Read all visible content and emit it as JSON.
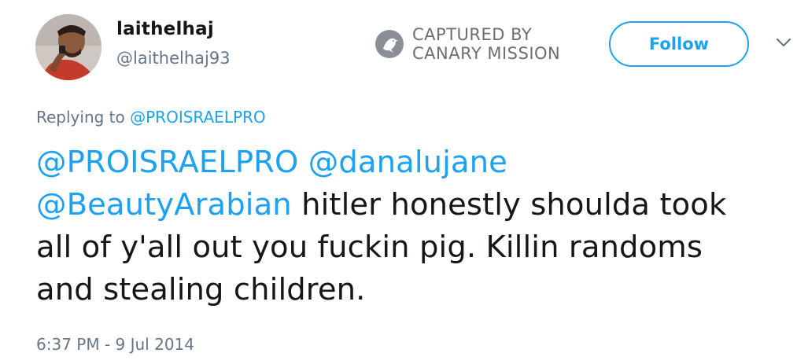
{
  "user": {
    "display_name": "laithelhaj",
    "handle": "@laithelhaj93",
    "avatar_icon": "profile-photo"
  },
  "watermark": {
    "line1": "CAPTURED BY",
    "line2": "CANARY MISSION",
    "icon": "canary-bird-icon"
  },
  "follow_button": {
    "label": "Follow"
  },
  "menu": {
    "icon": "chevron-down-icon"
  },
  "reply": {
    "prefix": "Replying to",
    "mention": "@PROISRAELPRO"
  },
  "tweet": {
    "mention1": "@PROISRAELPRO",
    "mention2": "@danalujane",
    "mention3": "@BeautyArabian",
    "line2_text": " hitler honestly shoulda took",
    "line3_text": "all of y'all out you fuckin pig. Killin randoms",
    "line4_text": "and stealing children."
  },
  "timestamp": "6:37 PM - 9 Jul 2014",
  "colors": {
    "link": "#1da1f2",
    "text": "#14171a",
    "muted": "#657786",
    "watermark": "#6a6f74"
  }
}
